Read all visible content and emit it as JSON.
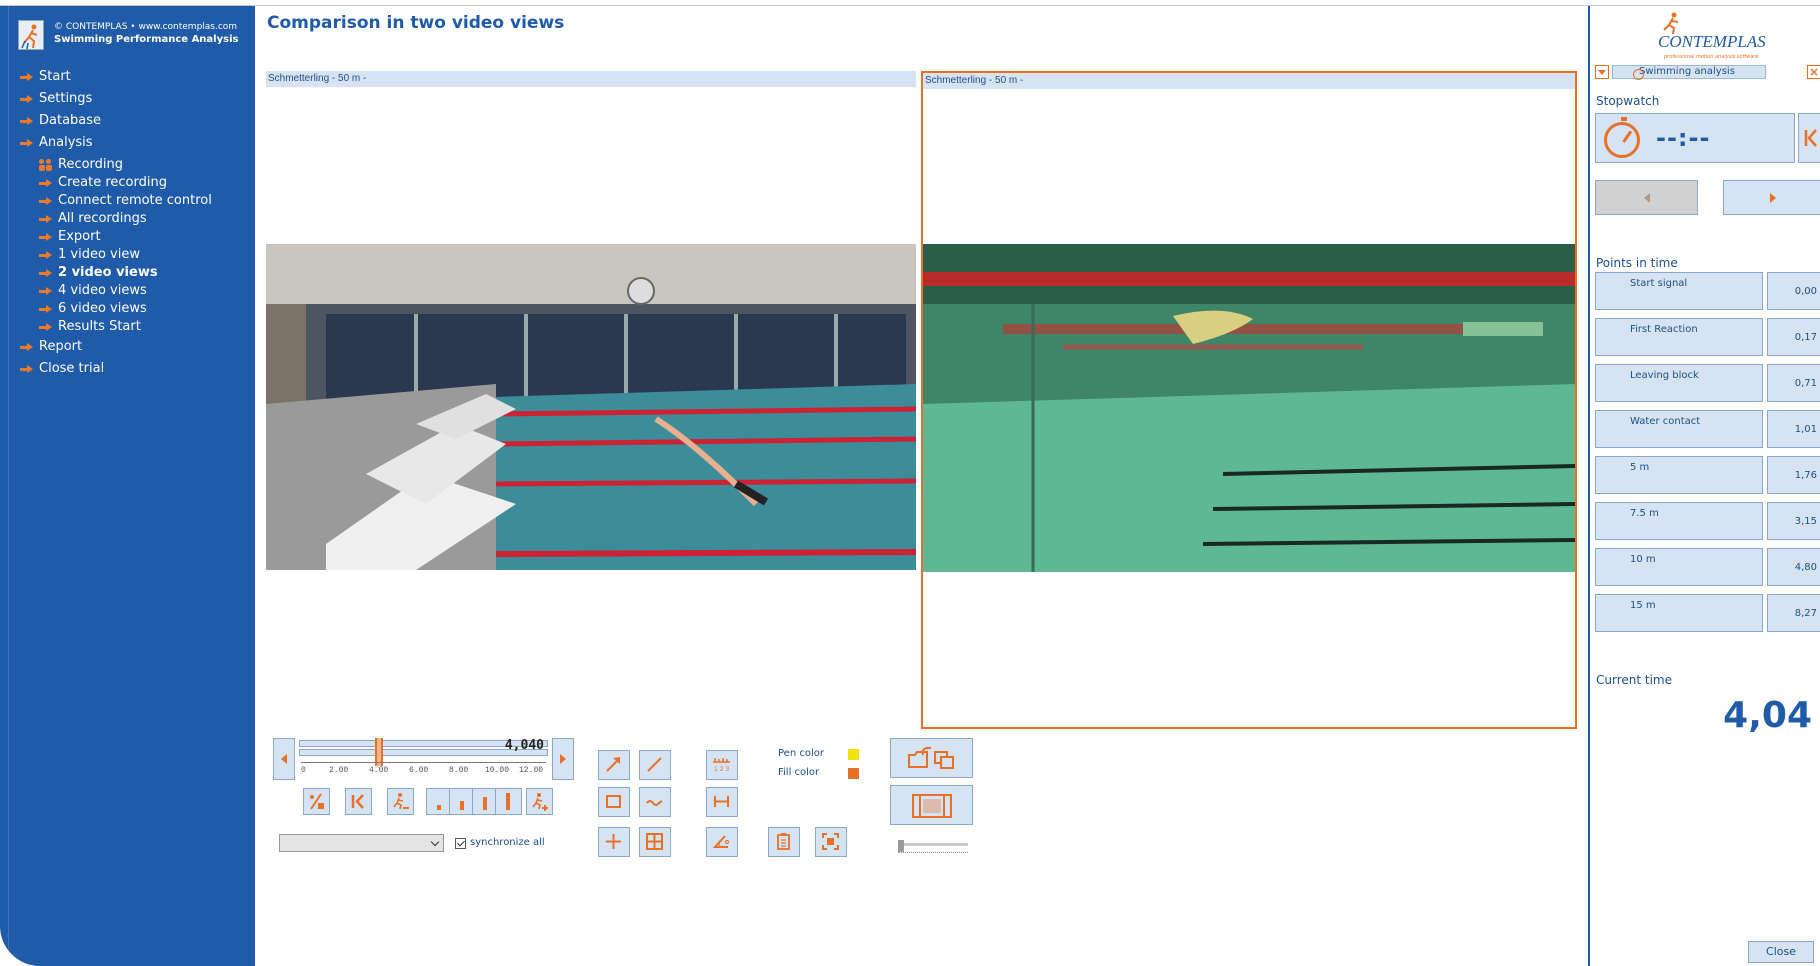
{
  "app": {
    "copyright": "© CONTEMPLAS • www.contemplas.com",
    "title": "Swimming Performance Analysis"
  },
  "nav": {
    "items": [
      {
        "label": "Start",
        "level": 0,
        "bold": false
      },
      {
        "label": "Settings",
        "level": 0,
        "bold": false
      },
      {
        "label": "Database",
        "level": 0,
        "bold": false
      },
      {
        "label": "Analysis",
        "level": 0,
        "bold": false
      },
      {
        "label": "Recording",
        "level": 1,
        "bold": false,
        "icon": "people-icon"
      },
      {
        "label": "Create recording",
        "level": 1,
        "bold": false
      },
      {
        "label": "Connect remote control",
        "level": 1,
        "bold": false
      },
      {
        "label": "All recordings",
        "level": 1,
        "bold": false
      },
      {
        "label": "Export",
        "level": 1,
        "bold": false
      },
      {
        "label": "1 video view",
        "level": 1,
        "bold": false
      },
      {
        "label": "2 video views",
        "level": 1,
        "bold": true
      },
      {
        "label": "4 video views",
        "level": 1,
        "bold": false
      },
      {
        "label": "6 video views",
        "level": 1,
        "bold": false
      },
      {
        "label": "Results Start",
        "level": 1,
        "bold": false
      },
      {
        "label": "Report",
        "level": 0,
        "bold": false
      },
      {
        "label": "Close trial",
        "level": 0,
        "bold": false
      }
    ]
  },
  "main": {
    "title": "Comparison in two video views",
    "videos": [
      {
        "label": "Schmetterling - 50 m -"
      },
      {
        "label": "Schmetterling - 50 m -"
      }
    ]
  },
  "timeline": {
    "value": "4,040",
    "ticks": [
      "0",
      "2.00",
      "4.00",
      "6.00",
      "8.00",
      "10.00",
      "12.00"
    ]
  },
  "sync": {
    "label": "synchronize all",
    "checked": true
  },
  "colors": {
    "pen_label": "Pen color",
    "fill_label": "Fill color",
    "pen": "#f5e10a",
    "fill": "#e8712a",
    "brand_blue": "#1f5ba8",
    "accent": "#e8712a"
  },
  "panel": {
    "logo": "CONTEMPLAS",
    "logo_sub": "professional motion analysis software",
    "module": "Swimming analysis",
    "stopwatch_label": "Stopwatch",
    "stopwatch_value": "--:--",
    "points_label": "Points in time",
    "points": [
      {
        "name": "Start signal",
        "value": "0,00"
      },
      {
        "name": "First Reaction",
        "value": "0,17"
      },
      {
        "name": "Leaving block",
        "value": "0,71"
      },
      {
        "name": "Water contact",
        "value": "1,01"
      },
      {
        "name": "5 m",
        "value": "1,76"
      },
      {
        "name": "7.5 m",
        "value": "3,15"
      },
      {
        "name": "10 m",
        "value": "4,80"
      },
      {
        "name": "15 m",
        "value": "8,27"
      }
    ],
    "current_time_label": "Current time",
    "current_time": "4,04",
    "close_label": "Close"
  }
}
